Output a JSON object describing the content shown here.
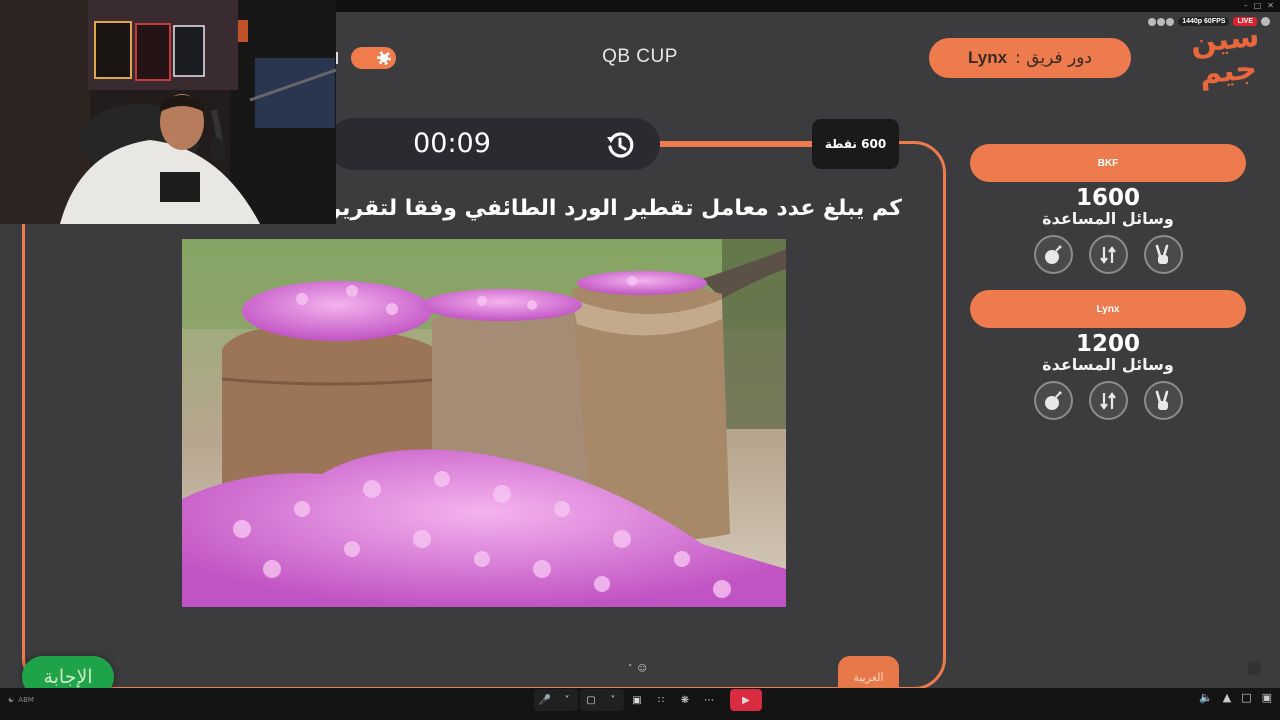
{
  "stream": {
    "quality": "1440p 60FPS",
    "live": "LIVE"
  },
  "header": {
    "title": "QB CUP",
    "turn_label": "دور فريق :",
    "turn_team": "Lynx",
    "logo_line1": "سين",
    "logo_line2": "جيم"
  },
  "question": {
    "timer": "00:09",
    "points": "600 نقطة",
    "text": "كم يبلغ عدد معامل تقطير الورد الطائفي وفقا لتقرير الوزارة"
  },
  "buttons": {
    "answer": "الإجابة",
    "strange": "الغريبة"
  },
  "teams": [
    {
      "name": "BKF",
      "score": "1600",
      "helpers_label": "وسائل المساعدة",
      "helpers": [
        "bomb-icon",
        "swap-icon",
        "victory-hand-icon"
      ]
    },
    {
      "name": "Lynx",
      "score": "1200",
      "helpers_label": "وسائل المساعدة",
      "helpers": [
        "bomb-icon",
        "swap-icon",
        "victory-hand-icon"
      ]
    }
  ],
  "taskbar": {
    "left_label": "ABM"
  },
  "colors": {
    "accent": "#ee7b4e",
    "panel": "#3c3c3e",
    "answer": "#1fa349",
    "live": "#e2212f"
  }
}
